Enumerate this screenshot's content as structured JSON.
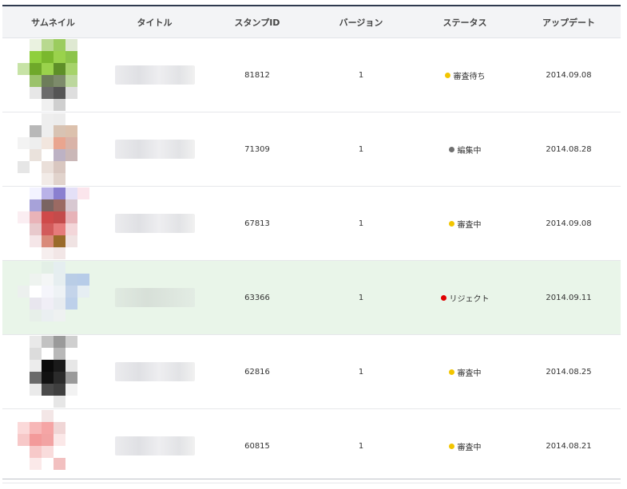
{
  "table": {
    "headers": {
      "thumbnail": "サムネイル",
      "title": "タイトル",
      "stamp_id": "スタンプID",
      "version": "バージョン",
      "status": "ステータス",
      "update": "アップデート"
    },
    "rows": [
      {
        "stamp_id": "81812",
        "version": "1",
        "status": "審査待ち",
        "status_color": "#f2c500",
        "update": "2014.09.08",
        "thumb_colors": [
          "#ffffff",
          "#eaf2e0",
          "#b8d98f",
          "#9bcc5e",
          "#dfe9d2",
          "#ffffff",
          "#ffffff",
          "#8fcf3d",
          "#7ab82e",
          "#9ad24c",
          "#8cc44a",
          "#ffffff",
          "#c7e3a6",
          "#6fa82a",
          "#9ad24c",
          "#5e8f28",
          "#a6d36a",
          "#ffffff",
          "#ffffff",
          "#9bc26b",
          "#6d7d5a",
          "#7d8b6b",
          "#bcd79d",
          "#ffffff",
          "#ffffff",
          "#e7e7e7",
          "#6b6b6b",
          "#555555",
          "#dedede",
          "#ffffff",
          "#ffffff",
          "#ffffff",
          "#f0f0f0",
          "#cfcfcf",
          "#ffffff",
          "#ffffff"
        ]
      },
      {
        "stamp_id": "71309",
        "version": "1",
        "status": "編集中",
        "status_color": "#707070",
        "update": "2014.08.28",
        "thumb_colors": [
          "#ffffff",
          "#ffffff",
          "#eeeeee",
          "#ececec",
          "#ffffff",
          "#ffffff",
          "#ffffff",
          "#b8b8b8",
          "#eeeeee",
          "#d8c3b3",
          "#dcc1ad",
          "#ffffff",
          "#f3f3f3",
          "#eeeeee",
          "#f2e6de",
          "#e9a58f",
          "#d9b3a8",
          "#ffffff",
          "#ffffff",
          "#eae2dc",
          "#ffffff",
          "#bdb2c4",
          "#cab7b7",
          "#ffffff",
          "#e6e6e6",
          "#ffffff",
          "#eadfd9",
          "#d9c7c0",
          "#ffffff",
          "#ffffff",
          "#ffffff",
          "#ffffff",
          "#f2ebe7",
          "#e1d3cc",
          "#ffffff",
          "#ffffff"
        ]
      },
      {
        "stamp_id": "67813",
        "version": "1",
        "status": "審査中",
        "status_color": "#f2c500",
        "update": "2014.09.08",
        "thumb_colors": [
          "#ffffff",
          "#f3f3ff",
          "#b9b2e8",
          "#8a7fd0",
          "#e4e0f7",
          "#fbe5ec",
          "#ffffff",
          "#a7a2d9",
          "#7a6462",
          "#9b6a63",
          "#d8c8d1",
          "#ffffff",
          "#fbeef2",
          "#e9b3b8",
          "#cf4a4a",
          "#c44b4b",
          "#e7b3b8",
          "#ffffff",
          "#ffffff",
          "#e8c9cc",
          "#d25b5b",
          "#e67b7b",
          "#f3d6d9",
          "#ffffff",
          "#ffffff",
          "#f5e6e8",
          "#d98a7a",
          "#9a6a2a",
          "#f0e3e3",
          "#ffffff",
          "#ffffff",
          "#ffffff",
          "#f6eeee",
          "#f2e6e6",
          "#ffffff",
          "#ffffff"
        ]
      },
      {
        "stamp_id": "63366",
        "version": "1",
        "status": "リジェクト",
        "status_color": "#e00000",
        "update": "2014.09.11",
        "highlight": true,
        "thumb_colors": [
          "#e9f5e9",
          "#e9f5e9",
          "#e3efe6",
          "#e5eef0",
          "#e9f5e9",
          "#e9f5e9",
          "#e9f5e9",
          "#eef3ef",
          "#f4f6f6",
          "#e6eef0",
          "#b9cde6",
          "#b7cce8",
          "#ecf0ee",
          "#ffffff",
          "#f5f5fb",
          "#eef2f5",
          "#c4d4ea",
          "#e6eef3",
          "#e9f5e9",
          "#e8e6ee",
          "#f0eef6",
          "#e8ecf0",
          "#bdd0ea",
          "#e9f5e9",
          "#e9f5e9",
          "#e7efe9",
          "#eaeff1",
          "#eef1f1",
          "#e9f5e9",
          "#e9f5e9",
          "#e9f5e9",
          "#e9f5e9",
          "#e9f5e9",
          "#e9f5e9",
          "#e9f5e9",
          "#e9f5e9"
        ]
      },
      {
        "stamp_id": "62816",
        "version": "1",
        "status": "審査中",
        "status_color": "#f2c500",
        "update": "2014.08.25",
        "thumb_colors": [
          "#ffffff",
          "#e9e9e9",
          "#c2c2c2",
          "#9a9a9a",
          "#cfcfcf",
          "#ffffff",
          "#ffffff",
          "#dcdcdc",
          "#ffffff",
          "#b8b8b8",
          "#ffffff",
          "#ffffff",
          "#ffffff",
          "#ececec",
          "#0a0a0a",
          "#1a1a1a",
          "#e7e7e7",
          "#ffffff",
          "#ffffff",
          "#6a6a6a",
          "#111111",
          "#2b2b2b",
          "#9a9a9a",
          "#ffffff",
          "#ffffff",
          "#eaeaea",
          "#4a4a4a",
          "#3f3f3f",
          "#f2f2f2",
          "#ffffff",
          "#ffffff",
          "#ffffff",
          "#ffffff",
          "#e6e6e6",
          "#ffffff",
          "#ffffff"
        ]
      },
      {
        "stamp_id": "60815",
        "version": "1",
        "status": "審査中",
        "status_color": "#f2c500",
        "update": "2014.08.21",
        "thumb_colors": [
          "#ffffff",
          "#ffffff",
          "#f3e6e6",
          "#ffffff",
          "#ffffff",
          "#ffffff",
          "#fbd9d9",
          "#f7b7b7",
          "#f5a5a5",
          "#f0d6d6",
          "#ffffff",
          "#ffffff",
          "#f7c8c8",
          "#f39a9a",
          "#f2a3a3",
          "#fbe8e8",
          "#ffffff",
          "#ffffff",
          "#ffffff",
          "#f7c9c9",
          "#f9dcdc",
          "#ffffff",
          "#ffffff",
          "#ffffff",
          "#ffffff",
          "#fbe9e9",
          "#ffffff",
          "#f2c0c0",
          "#ffffff",
          "#ffffff",
          "#ffffff",
          "#ffffff",
          "#ffffff",
          "#ffffff",
          "#ffffff",
          "#ffffff"
        ]
      }
    ]
  }
}
